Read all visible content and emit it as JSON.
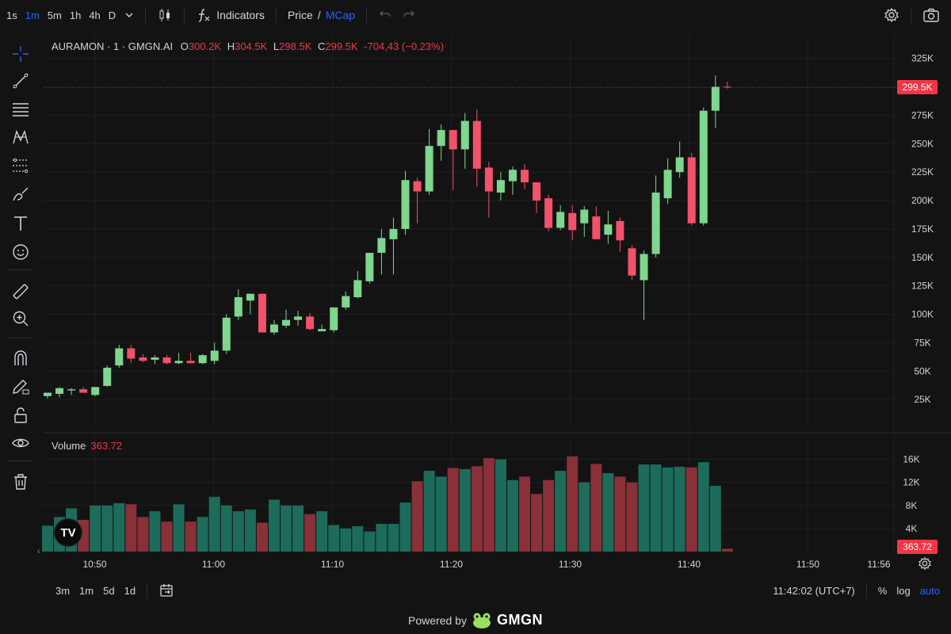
{
  "topbar": {
    "timeframes": [
      "1s",
      "1m",
      "5m",
      "1h",
      "4h",
      "D"
    ],
    "active_timeframe": "1m",
    "indicators_label": "Indicators",
    "price_label": "Price",
    "slash": "/",
    "mcap_label": "MCap"
  },
  "legend": {
    "symbol": "AURAMON · 1 · GMGN.AI",
    "o_label": "O",
    "o_value": "300.2K",
    "h_label": "H",
    "h_value": "304.5K",
    "l_label": "L",
    "l_value": "298.5K",
    "c_label": "C",
    "c_value": "299.5K",
    "change": "-704,43 (−0.23%)"
  },
  "volume": {
    "label": "Volume",
    "value": "363.72",
    "axis_ticks": [
      "16K",
      "12K",
      "8K",
      "4K"
    ],
    "axis_tick_values": [
      16000,
      12000,
      8000,
      4000
    ],
    "last_tag": "363.72"
  },
  "price_axis": {
    "ticks": [
      "325K",
      "275K",
      "250K",
      "225K",
      "200K",
      "175K",
      "150K",
      "125K",
      "100K",
      "75K",
      "50K",
      "25K"
    ],
    "tick_values": [
      325000,
      275000,
      250000,
      225000,
      200000,
      175000,
      150000,
      125000,
      100000,
      75000,
      50000,
      25000
    ],
    "current_tag": "299.5K",
    "current_value": 299500
  },
  "time_axis": {
    "labels": [
      "10:50",
      "11:00",
      "11:10",
      "11:20",
      "11:30",
      "11:40",
      "11:50",
      "11:56"
    ]
  },
  "bottombar": {
    "ranges": [
      "3m",
      "1m",
      "5d",
      "1d"
    ],
    "clock": "11:42:02 (UTC+7)",
    "percent": "%",
    "log": "log",
    "auto": "auto"
  },
  "footer": {
    "powered": "Powered by",
    "brand": "GMGN"
  },
  "colors": {
    "up": "#7fd68f",
    "down": "#f2526a",
    "vol_up": "#1d6b5b",
    "vol_down": "#8a3038",
    "accent": "#2962ff",
    "background": "#131313"
  },
  "chart_data": {
    "type": "candlestick",
    "candles": [
      {
        "o": 28000,
        "h": 31000,
        "l": 26000,
        "c": 31000
      },
      {
        "o": 30000,
        "h": 36000,
        "l": 27000,
        "c": 35000
      },
      {
        "o": 33000,
        "h": 35000,
        "l": 29000,
        "c": 34000
      },
      {
        "o": 34000,
        "h": 36000,
        "l": 32000,
        "c": 31000
      },
      {
        "o": 29000,
        "h": 36000,
        "l": 28000,
        "c": 36000
      },
      {
        "o": 37000,
        "h": 55000,
        "l": 36000,
        "c": 53000
      },
      {
        "o": 55000,
        "h": 73000,
        "l": 53000,
        "c": 70000
      },
      {
        "o": 70000,
        "h": 73000,
        "l": 57000,
        "c": 61000
      },
      {
        "o": 62000,
        "h": 65000,
        "l": 58000,
        "c": 59000
      },
      {
        "o": 60000,
        "h": 64000,
        "l": 56000,
        "c": 62000
      },
      {
        "o": 62000,
        "h": 64000,
        "l": 56000,
        "c": 57000
      },
      {
        "o": 57000,
        "h": 66000,
        "l": 56000,
        "c": 59000
      },
      {
        "o": 59000,
        "h": 66000,
        "l": 57000,
        "c": 57000
      },
      {
        "o": 57000,
        "h": 65000,
        "l": 56000,
        "c": 64000
      },
      {
        "o": 59000,
        "h": 75000,
        "l": 56000,
        "c": 68000
      },
      {
        "o": 68000,
        "h": 100000,
        "l": 65000,
        "c": 97000
      },
      {
        "o": 98000,
        "h": 122000,
        "l": 95000,
        "c": 115000
      },
      {
        "o": 112000,
        "h": 118000,
        "l": 100000,
        "c": 118000
      },
      {
        "o": 118000,
        "h": 118000,
        "l": 84000,
        "c": 84000
      },
      {
        "o": 84000,
        "h": 95000,
        "l": 82000,
        "c": 91000
      },
      {
        "o": 90000,
        "h": 104000,
        "l": 88000,
        "c": 95000
      },
      {
        "o": 95000,
        "h": 103000,
        "l": 90000,
        "c": 98000
      },
      {
        "o": 98000,
        "h": 101000,
        "l": 86000,
        "c": 87000
      },
      {
        "o": 85000,
        "h": 91000,
        "l": 85000,
        "c": 87000
      },
      {
        "o": 86000,
        "h": 100000,
        "l": 84000,
        "c": 106000
      },
      {
        "o": 106000,
        "h": 120000,
        "l": 104000,
        "c": 116000
      },
      {
        "o": 115000,
        "h": 138000,
        "l": 114000,
        "c": 130000
      },
      {
        "o": 129000,
        "h": 150000,
        "l": 127000,
        "c": 154000
      },
      {
        "o": 154000,
        "h": 175000,
        "l": 135000,
        "c": 167000
      },
      {
        "o": 166000,
        "h": 185000,
        "l": 135000,
        "c": 175000
      },
      {
        "o": 175000,
        "h": 226000,
        "l": 170000,
        "c": 218000
      },
      {
        "o": 217000,
        "h": 220000,
        "l": 180000,
        "c": 208000
      },
      {
        "o": 208000,
        "h": 263000,
        "l": 205000,
        "c": 248000
      },
      {
        "o": 248000,
        "h": 267000,
        "l": 235000,
        "c": 262000
      },
      {
        "o": 262000,
        "h": 262000,
        "l": 209000,
        "c": 245000
      },
      {
        "o": 245000,
        "h": 277000,
        "l": 228000,
        "c": 270000
      },
      {
        "o": 270000,
        "h": 280000,
        "l": 212000,
        "c": 228000
      },
      {
        "o": 229000,
        "h": 234000,
        "l": 185000,
        "c": 208000
      },
      {
        "o": 207000,
        "h": 225000,
        "l": 200000,
        "c": 218000
      },
      {
        "o": 217000,
        "h": 230000,
        "l": 205000,
        "c": 227000
      },
      {
        "o": 227000,
        "h": 232000,
        "l": 210000,
        "c": 216000
      },
      {
        "o": 216000,
        "h": 216000,
        "l": 189000,
        "c": 200000
      },
      {
        "o": 202000,
        "h": 205000,
        "l": 173000,
        "c": 176000
      },
      {
        "o": 176000,
        "h": 196000,
        "l": 174000,
        "c": 190000
      },
      {
        "o": 189000,
        "h": 196000,
        "l": 165000,
        "c": 174000
      },
      {
        "o": 180000,
        "h": 195000,
        "l": 168000,
        "c": 192000
      },
      {
        "o": 186000,
        "h": 195000,
        "l": 170000,
        "c": 166000
      },
      {
        "o": 170000,
        "h": 191000,
        "l": 162000,
        "c": 179000
      },
      {
        "o": 182000,
        "h": 185000,
        "l": 155000,
        "c": 165000
      },
      {
        "o": 158000,
        "h": 161000,
        "l": 130000,
        "c": 134000
      },
      {
        "o": 130000,
        "h": 156000,
        "l": 95000,
        "c": 153000
      },
      {
        "o": 153000,
        "h": 222000,
        "l": 150000,
        "c": 207000
      },
      {
        "o": 202000,
        "h": 237000,
        "l": 197000,
        "c": 227000
      },
      {
        "o": 225000,
        "h": 252000,
        "l": 220000,
        "c": 238000
      },
      {
        "o": 238000,
        "h": 242000,
        "l": 178000,
        "c": 180000
      },
      {
        "o": 180000,
        "h": 282000,
        "l": 178000,
        "c": 279000
      },
      {
        "o": 279000,
        "h": 310000,
        "l": 264000,
        "c": 300000
      },
      {
        "o": 300200,
        "h": 304500,
        "l": 298500,
        "c": 299500
      }
    ],
    "volumes": [
      4500,
      6000,
      7500,
      5500,
      8000,
      8000,
      8400,
      8200,
      6000,
      7000,
      5200,
      8200,
      5200,
      6000,
      9500,
      8000,
      7000,
      7300,
      5000,
      9000,
      8000,
      8000,
      6500,
      7000,
      4600,
      4000,
      4400,
      3500,
      4800,
      4800,
      8500,
      12200,
      14000,
      13000,
      14500,
      14300,
      14800,
      16200,
      16000,
      12400,
      13000,
      10000,
      12400,
      14000,
      16500,
      12000,
      15200,
      13600,
      13000,
      12000,
      15100,
      15100,
      14600,
      14700,
      14600,
      15500,
      11400,
      500
    ],
    "ylim_price": [
      0,
      345000
    ],
    "ylim_volume": [
      0,
      18000
    ]
  }
}
